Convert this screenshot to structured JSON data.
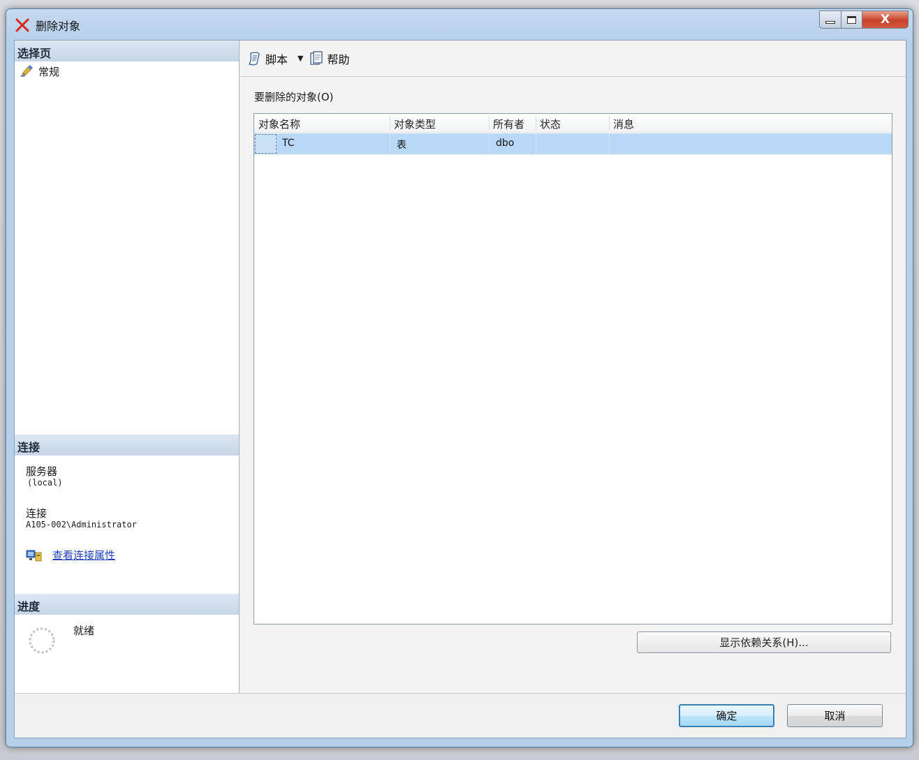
{
  "window": {
    "title": "删除对象",
    "caption_close": "X"
  },
  "left_pane": {
    "select_page_header": "选择页",
    "nav_items": [
      {
        "label": "常规"
      }
    ],
    "connection_header": "连接",
    "server_label": "服务器",
    "server_value": "(local)",
    "connection_label": "连接",
    "connection_value": "A105-002\\Administrator",
    "view_connection_link": "查看连接属性",
    "progress_header": "进度",
    "progress_status": "就绪"
  },
  "toolbar": {
    "script_label": "脚本",
    "dropdown_arrow": "▼",
    "help_label": "帮助"
  },
  "objects": {
    "label": "要删除的对象(O)",
    "columns": [
      "对象名称",
      "对象类型",
      "所有者",
      "状态",
      "消息"
    ],
    "rows": [
      {
        "name": "TC",
        "type": "表",
        "owner": "dbo",
        "status": "",
        "message": ""
      }
    ]
  },
  "buttons": {
    "show_dependencies": "显示依赖关系(H)...",
    "ok": "确定",
    "cancel": "取消"
  }
}
